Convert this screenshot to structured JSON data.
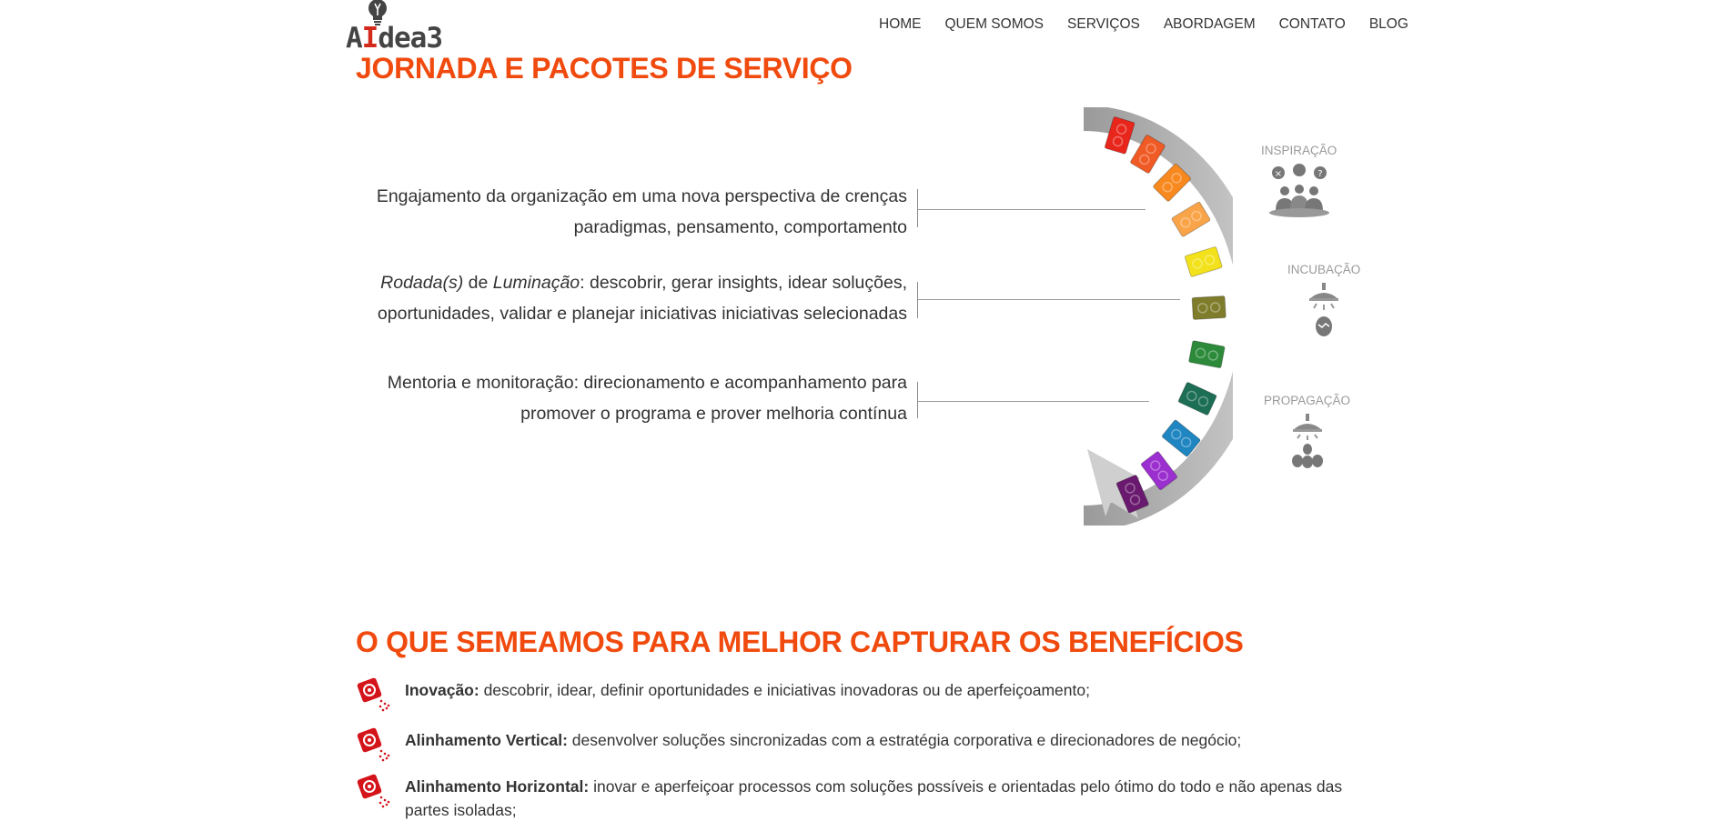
{
  "header": {
    "logo_prefix": "A",
    "logo_highlight": "I",
    "logo_suffix": "dea3",
    "nav": [
      "HOME",
      "QUEM SOMOS",
      "SERVIÇOS",
      "ABORDAGEM",
      "CONTATO",
      "BLOG"
    ]
  },
  "journey": {
    "title": "JORNADA E PACOTES DE SERVIÇO",
    "items": [
      {
        "line1": "Engajamento da organização em uma nova perspectiva de crenças",
        "line2": "paradigmas, pensamento, comportamento"
      },
      {
        "line1_em1": "Rodada(s)",
        "line1_mid": " de ",
        "line1_em2": "Luminação",
        "line1_rest": ":  descobrir, gerar insights, idear soluções,",
        "line2": "oportunidades, validar e planejar iniciativas iniciativas selecionadas"
      },
      {
        "line1": "Mentoria e monitoração: direcionamento e acompanhamento para",
        "line2": "promover o programa e prover melhoria contínua"
      }
    ],
    "phases": [
      "INSPIRAÇÃO",
      "INCUBAÇÃO",
      "PROPAGAÇÃO"
    ],
    "block_colors": [
      "#e8261c",
      "#f05a24",
      "#f7891f",
      "#f9a448",
      "#f3e21b",
      "#7f7d2c",
      "#2c8a3a",
      "#1c6e55",
      "#1f86c1",
      "#9b2fcf",
      "#6a1a6e"
    ]
  },
  "benefits": {
    "title": "O QUE SEMEAMOS PARA MELHOR CAPTURAR OS BENEFÍCIOS",
    "items": [
      {
        "label": "Inovação:",
        "text": " descobrir, idear, definir oportunidades e iniciativas inovadoras ou de aperfeiçoamento;"
      },
      {
        "label": "Alinhamento Vertical:",
        "text": " desenvolver soluções sincronizadas com a estratégia corporativa e direcionadores de negócio;"
      },
      {
        "label": "Alinhamento Horizontal:",
        "text": " inovar e aperfeiçoar processos com soluções possíveis e orientadas pelo ótimo do todo e não apenas das partes isoladas;"
      }
    ]
  }
}
